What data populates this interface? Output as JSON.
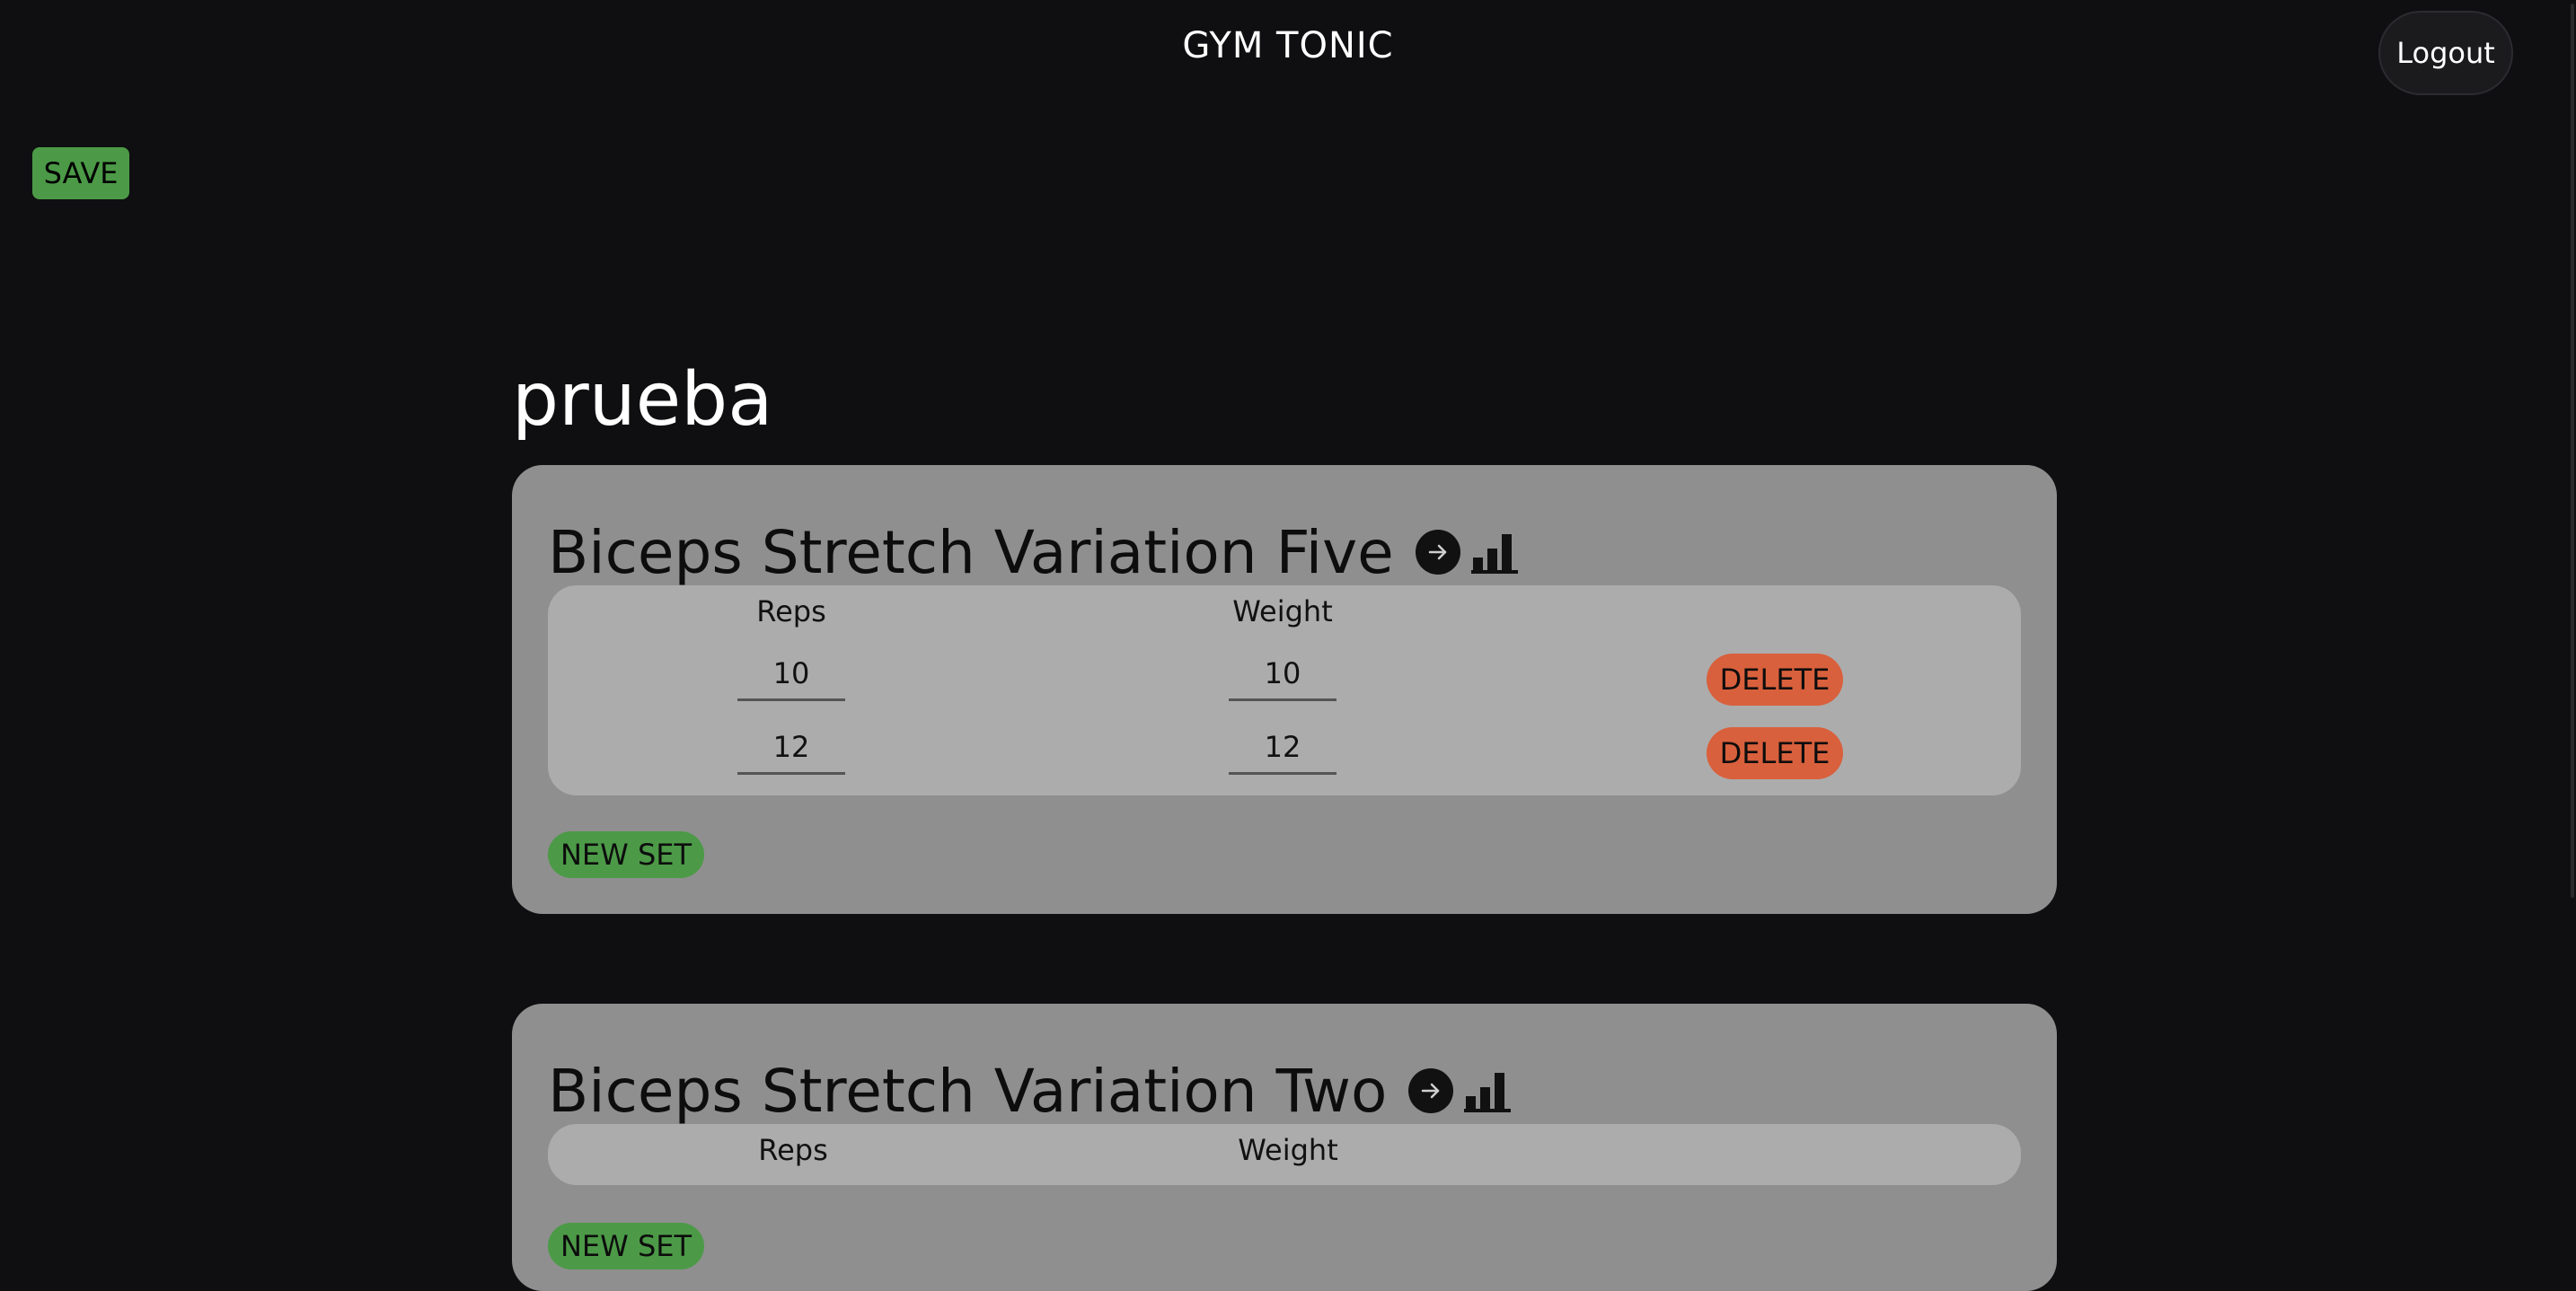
{
  "header": {
    "title": "GYM TONIC",
    "logout_label": "Logout"
  },
  "toolbar": {
    "save_label": "SAVE"
  },
  "routine": {
    "name": "prueba",
    "exercises": [
      {
        "title": "Biceps Stretch Variation Five",
        "reps_header": "Reps",
        "weight_header": "Weight",
        "sets": [
          {
            "reps": "10",
            "weight": "10",
            "delete_label": "DELETE"
          },
          {
            "reps": "12",
            "weight": "12",
            "delete_label": "DELETE"
          }
        ],
        "new_set_label": "NEW SET"
      },
      {
        "title": "Biceps Stretch Variation Two",
        "reps_header": "Reps",
        "weight_header": "Weight",
        "sets": [],
        "new_set_label": "NEW SET"
      }
    ]
  },
  "icons": {
    "go": "arrow-right-circle-icon",
    "stats": "bar-chart-icon"
  },
  "colors": {
    "background": "#0f0f11",
    "card": "#8f8f8f",
    "sets_box": "#acacac",
    "save_green": "#4c9a47",
    "delete_orange": "#d9603c"
  }
}
